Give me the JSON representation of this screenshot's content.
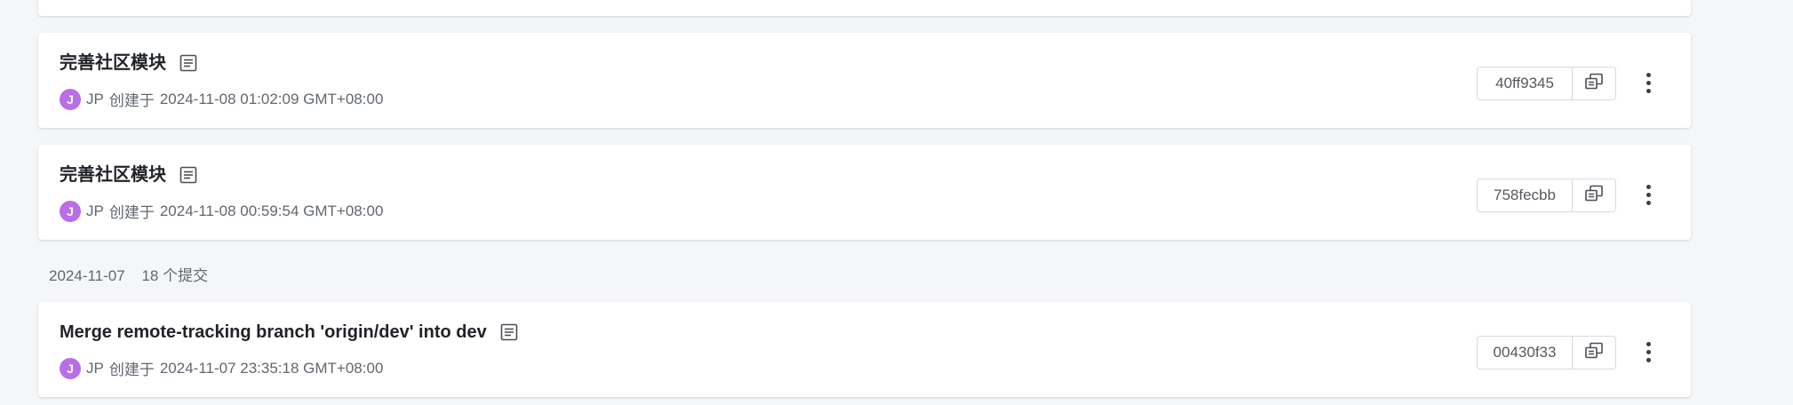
{
  "groups": [
    {
      "date": "2024-11-07",
      "count_label": "18 个提交"
    }
  ],
  "commits": [
    {
      "title": "完善社区模块",
      "avatar_initial": "J",
      "author": "JP",
      "created_label": "创建于",
      "timestamp": "2024-11-08 01:02:09 GMT+08:00",
      "hash": "40ff9345"
    },
    {
      "title": "完善社区模块",
      "avatar_initial": "J",
      "author": "JP",
      "created_label": "创建于",
      "timestamp": "2024-11-08 00:59:54 GMT+08:00",
      "hash": "758fecbb"
    },
    {
      "title": "Merge remote-tracking branch 'origin/dev' into dev",
      "avatar_initial": "J",
      "author": "JP",
      "created_label": "创建于",
      "timestamp": "2024-11-07 23:35:18 GMT+08:00",
      "hash": "00430f33"
    }
  ],
  "icons": {
    "description": "doc-lines-icon",
    "copy": "copy-icon",
    "more": "more-vertical-icon"
  },
  "colors": {
    "avatar": "#b86ee8",
    "background": "#f5f6f8"
  }
}
